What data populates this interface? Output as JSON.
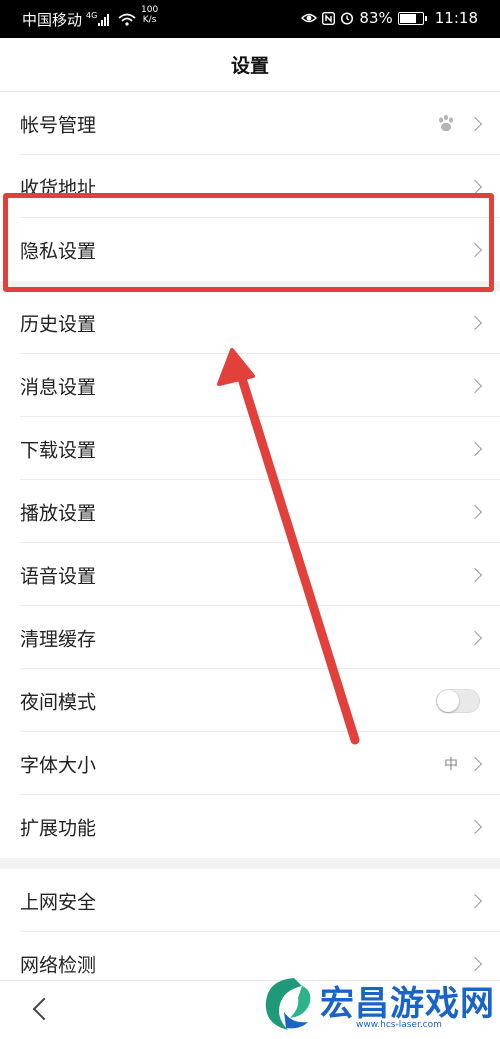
{
  "status_bar": {
    "carrier": "中国移动",
    "network": "4G",
    "speed_value": "100",
    "speed_unit": "K/s",
    "battery": "83%",
    "battery_level": 0.83,
    "time": "11:18"
  },
  "header": {
    "title": "设置"
  },
  "settings": {
    "account": {
      "label": "帐号管理"
    },
    "address": {
      "label": "收货地址"
    },
    "privacy": {
      "label": "隐私设置"
    },
    "history": {
      "label": "历史设置"
    },
    "message": {
      "label": "消息设置"
    },
    "download": {
      "label": "下载设置"
    },
    "playback": {
      "label": "播放设置"
    },
    "voice": {
      "label": "语音设置"
    },
    "cache": {
      "label": "清理缓存"
    },
    "night": {
      "label": "夜间模式",
      "enabled": false
    },
    "font": {
      "label": "字体大小",
      "value": "中"
    },
    "extensions": {
      "label": "扩展功能"
    },
    "security": {
      "label": "上网安全"
    },
    "network_check": {
      "label": "网络检测"
    }
  },
  "annotation": {
    "color": "#e2403a"
  },
  "watermark": {
    "title": "宏昌游戏网",
    "url": "www.hcs-laser.com",
    "color": "#1a63c7"
  }
}
